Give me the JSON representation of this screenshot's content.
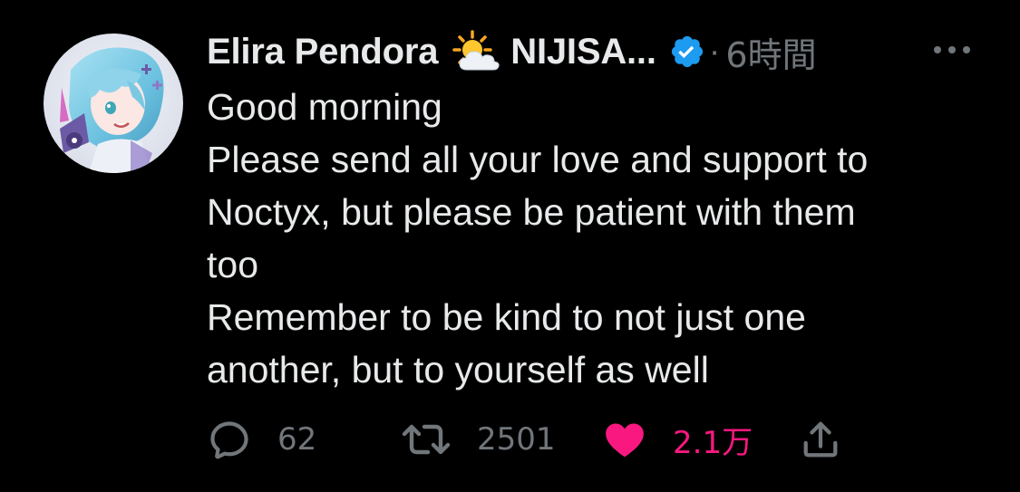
{
  "tweet": {
    "display_name": "Elira Pendora",
    "name_suffix": "NIJISA...",
    "separator": "·",
    "timestamp": "6時間",
    "body_lines": [
      "Good morning",
      "Please send all your love and support to",
      "Noctyx, but please be patient with them",
      "too",
      "Remember to be kind to not just one",
      "another, but to yourself as well"
    ]
  },
  "actions": {
    "reply_count": "62",
    "retweet_count": "2501",
    "like_count": "2.1万"
  },
  "icons": {
    "avatar": "avatar-image",
    "weather": "sun-behind-cloud-icon",
    "verified": "verified-badge-icon",
    "more": "more-options-icon",
    "reply": "reply-icon",
    "retweet": "retweet-icon",
    "like": "heart-icon",
    "share": "share-icon"
  },
  "colors": {
    "background": "#000000",
    "text": "#e7e9ea",
    "muted": "#71767b",
    "like": "#f91880",
    "verified": "#1d9bf0"
  }
}
